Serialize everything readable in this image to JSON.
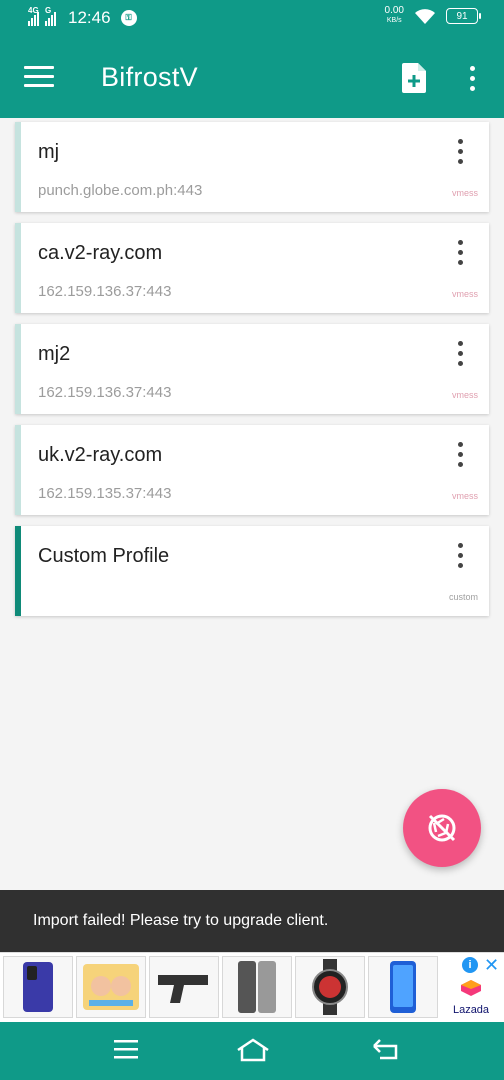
{
  "status_bar": {
    "sim1_label": "4G",
    "sim2_label": "G",
    "time": "12:46",
    "speed_value": "0.00",
    "speed_unit": "KB/s",
    "battery": "91"
  },
  "app_bar": {
    "title": "BifrostV",
    "menu_icon": "hamburger-icon",
    "add_icon": "add-file-icon",
    "overflow_icon": "more-vert-icon"
  },
  "profiles": [
    {
      "name": "mj",
      "address": "punch.globe.com.ph:443",
      "type": "vmess",
      "active": false
    },
    {
      "name": "ca.v2-ray.com",
      "address": "162.159.136.37:443",
      "type": "vmess",
      "active": false
    },
    {
      "name": "mj2",
      "address": "162.159.136.37:443",
      "type": "vmess",
      "active": false
    },
    {
      "name": "uk.v2-ray.com",
      "address": "162.159.135.37:443",
      "type": "vmess",
      "active": false
    },
    {
      "name": "Custom Profile",
      "address": "",
      "type": "custom",
      "active": true
    }
  ],
  "fab": {
    "icon": "vpn-off-icon",
    "color": "#f25283"
  },
  "snackbar": {
    "message": "Import failed! Please try to upgrade client."
  },
  "ad_banner": {
    "products": [
      "phone-case-product",
      "kids-toy-product",
      "toy-pistol-product",
      "smartphone-product",
      "smartwatch-product",
      "blue-smartphone-product"
    ],
    "brand": "Lazada",
    "info_icon": "info-icon",
    "close_icon": "close-icon"
  },
  "nav_bar": {
    "icons": [
      "recents-icon",
      "home-icon",
      "back-icon"
    ]
  },
  "colors": {
    "primary": "#0f9a88",
    "accent": "#f25283",
    "active_indicator": "#0f8a78"
  }
}
